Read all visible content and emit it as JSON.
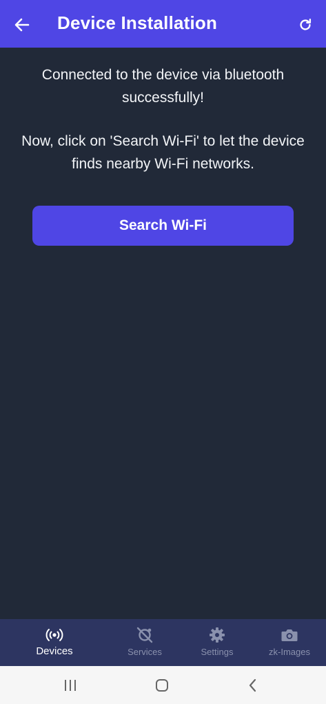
{
  "header": {
    "title": "Device Installation",
    "back_icon": "arrow-left-icon",
    "refresh_icon": "refresh-icon",
    "background_color": "#4f46e5"
  },
  "main": {
    "message_line1": "Connected to the device via bluetooth successfully!",
    "message_line2": "Now, click on 'Search Wi-Fi' to let the device finds nearby Wi-Fi networks.",
    "search_button_label": "Search Wi-Fi",
    "background_color": "#212938"
  },
  "bottom_nav": {
    "active": "Devices",
    "items": [
      {
        "label": "Devices",
        "icon": "broadcast-icon"
      },
      {
        "label": "Services",
        "icon": "services-icon"
      },
      {
        "label": "Settings",
        "icon": "gear-icon"
      },
      {
        "label": "zk-Images",
        "icon": "camera-icon"
      }
    ]
  },
  "system_nav": {
    "icons": [
      "recent-apps-icon",
      "home-icon",
      "back-icon"
    ]
  }
}
